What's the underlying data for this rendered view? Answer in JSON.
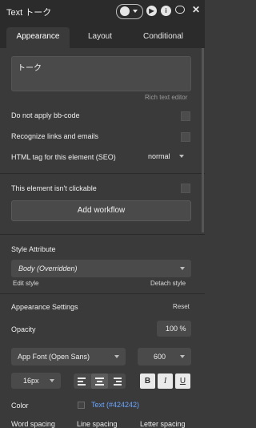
{
  "header": {
    "title": "Text トーク"
  },
  "tabs": [
    {
      "label": "Appearance",
      "active": true
    },
    {
      "label": "Layout",
      "active": false
    },
    {
      "label": "Conditional",
      "active": false
    }
  ],
  "editor": {
    "value": "トーク",
    "hint": "Rich text editor"
  },
  "options": {
    "bbcode": "Do not apply bb-code",
    "links": "Recognize links and emails",
    "html_tag_label": "HTML tag for this element (SEO)",
    "html_tag_value": "normal",
    "not_clickable": "This element isn't clickable"
  },
  "workflow": {
    "label": "Add workflow"
  },
  "style": {
    "label": "Style Attribute",
    "value": "Body (Overridden)",
    "edit": "Edit style",
    "detach": "Detach style"
  },
  "appearance": {
    "title": "Appearance Settings",
    "reset": "Reset",
    "opacity_label": "Opacity",
    "opacity_value": "100 %",
    "font": "App Font (Open Sans)",
    "weight": "600",
    "size": "16px",
    "bold": "B",
    "italic": "I",
    "underline": "U",
    "color_label": "Color",
    "color_value": "Text (#424242)",
    "color_swatch": "#424242",
    "word_spacing": "Word spacing",
    "line_spacing": "Line spacing",
    "letter_spacing": "Letter spacing"
  },
  "colors": {
    "panel": "#3a3a3a",
    "header": "#2b2b2b",
    "field": "#4a4a4a",
    "link": "#6aa6ff"
  }
}
